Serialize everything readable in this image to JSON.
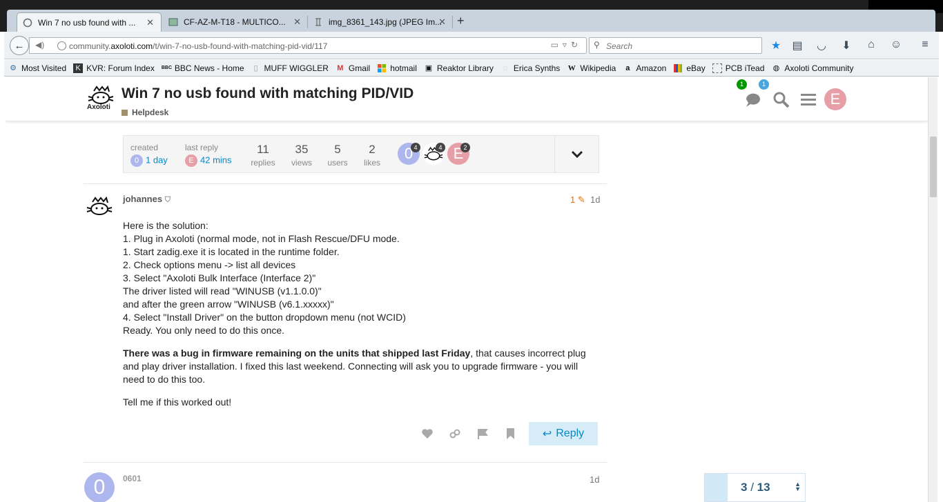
{
  "browser": {
    "tabs": [
      {
        "title": "Win 7 no usb found with ...",
        "active": true
      },
      {
        "title": "CF-AZ-M-T18 - MULTICO...",
        "active": false
      },
      {
        "title": "img_8361_143.jpg (JPEG Im...",
        "active": false
      }
    ],
    "new_tab": "+",
    "url_domain": "community.",
    "url_host": "axoloti.com",
    "url_path": "/t/win-7-no-usb-found-with-matching-pid-vid/117",
    "search_placeholder": "Search",
    "bookmarks": [
      {
        "label": "Most Visited",
        "icon": "gear-icon"
      },
      {
        "label": "KVR: Forum Index",
        "icon": "kvr-icon"
      },
      {
        "label": "BBC News - Home",
        "icon": "bbc-icon"
      },
      {
        "label": "MUFF WIGGLER",
        "icon": "page-icon"
      },
      {
        "label": "Gmail",
        "icon": "gmail-icon"
      },
      {
        "label": "hotmail",
        "icon": "windows-icon"
      },
      {
        "label": "Reaktor Library",
        "icon": "reaktor-icon"
      },
      {
        "label": "Erica Synths",
        "icon": "erica-icon"
      },
      {
        "label": "Wikipedia",
        "icon": "wikipedia-icon"
      },
      {
        "label": "Amazon",
        "icon": "amazon-icon"
      },
      {
        "label": "eBay",
        "icon": "ebay-icon"
      },
      {
        "label": "PCB iTead",
        "icon": "dashed-page-icon"
      },
      {
        "label": "Axoloti Community",
        "icon": "axoloti-icon"
      }
    ]
  },
  "header": {
    "logo_text": "Axoloti",
    "title": "Win 7 no usb found with matching PID/VID",
    "category": "Helpdesk",
    "category_color": "#9f8f6d",
    "notif_green": "1",
    "notif_blue": "1",
    "user_initial": "E"
  },
  "topic_map": {
    "created_label": "created",
    "created_value": "1 day",
    "created_avatar": "0",
    "last_reply_label": "last reply",
    "last_reply_value": "42 mins",
    "last_reply_avatar": "E",
    "replies": "11",
    "replies_label": "replies",
    "views": "35",
    "views_label": "views",
    "users": "5",
    "users_label": "users",
    "likes": "2",
    "likes_label": "likes",
    "participants": [
      {
        "initial": "0",
        "count": "4",
        "color": "#aeb6ee"
      },
      {
        "initial": "",
        "count": "4",
        "color": "#ffffff"
      },
      {
        "initial": "E",
        "count": "2",
        "color": "#e79fa7"
      }
    ]
  },
  "post": {
    "username": "johannes",
    "edits": "1",
    "age": "1d",
    "lines": [
      "Here is the solution:",
      "1. Plug in Axoloti (normal mode, not in Flash Rescue/DFU mode.",
      "1. Start zadig.exe it is located in the runtime folder.",
      "2. Check options menu -> list all devices",
      "3. Select \"Axoloti Bulk Interface (Interface 2)\"",
      "The driver listed will read \"WINUSB (v1.1.0.0)\"",
      "and after the green arrow \"WINUSB (v6.1.xxxxx)\"",
      "4. Select \"Install Driver\" on the button dropdown menu (not WCID)",
      "Ready. You only need to do this once."
    ],
    "para2_bold": "There was a bug in firmware remaining on the units that shipped last Friday",
    "para2_rest": ", that causes incorrect plug and play driver installation. I fixed this last weekend. Connecting will ask you to upgrade firmware - you will need to do this too.",
    "para3": "Tell me if this worked out!",
    "reply_label": "Reply"
  },
  "next_post": {
    "avatar": "0",
    "username": "0601",
    "age": "1d"
  },
  "progress": {
    "current": "3",
    "total": "13",
    "sep": " / ",
    "fraction": 0.23
  }
}
